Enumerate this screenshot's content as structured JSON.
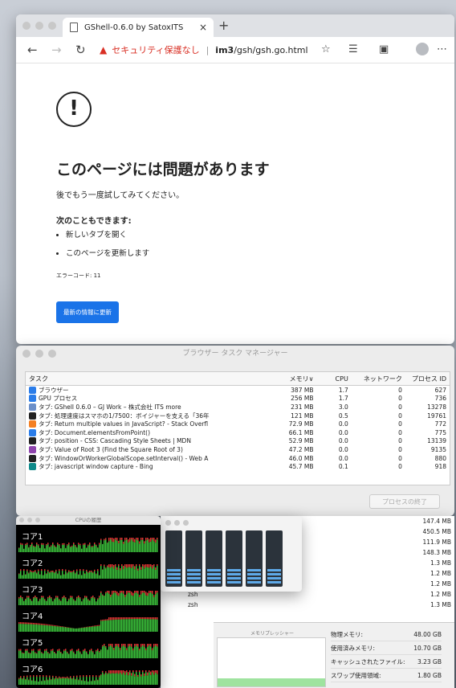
{
  "browser": {
    "tab_title": "GShell-0.6.0 by SatoxITS",
    "tab_close": "×",
    "new_tab": "+",
    "back": "←",
    "forward": "→",
    "reload": "↻",
    "insecure_label": "セキュリティ保護なし",
    "url_sep": "|",
    "url_host": "im3",
    "url_path": "/gsh/gsh.go.html",
    "error": {
      "heading": "このページには問題があります",
      "retry_text": "後でもう一度試してみてください。",
      "also_heading": "次のこともできます:",
      "suggestions": [
        "新しいタブを開く",
        "このページを更新します"
      ],
      "error_code": "エラーコード: 11",
      "reload_button": "最新の情報に更新"
    }
  },
  "task_manager": {
    "title": "ブラウザー タスク マネージャー",
    "columns": {
      "task": "タスク",
      "memory": "メモリ∨",
      "cpu": "CPU",
      "network": "ネットワーク",
      "pid": "プロセス ID"
    },
    "rows": [
      {
        "task": "ブラウザー",
        "memory": "387 MB",
        "cpu": "1.7",
        "network": "0",
        "pid": "627",
        "icon_color": "#2b7de9"
      },
      {
        "task": "GPU プロセス",
        "memory": "256 MB",
        "cpu": "1.7",
        "network": "0",
        "pid": "736",
        "icon_color": "#2b7de9"
      },
      {
        "task": "タブ: GShell 0.6.0 – GJ Work – 株式会社 ITS more",
        "memory": "231 MB",
        "cpu": "3.0",
        "network": "0",
        "pid": "13278",
        "icon_color": "#6b8fc9"
      },
      {
        "task": "タブ: 処理速度はスマホの1/7500：ボイジャーを支える「36年",
        "memory": "121 MB",
        "cpu": "0.5",
        "network": "0",
        "pid": "19761",
        "icon_color": "#222222"
      },
      {
        "task": "タブ: Return multiple values in JavaScript? - Stack Overfl",
        "memory": "72.9 MB",
        "cpu": "0.0",
        "network": "0",
        "pid": "772",
        "icon_color": "#f48024"
      },
      {
        "task": "タブ: Document.elementsFromPoint()",
        "memory": "66.1 MB",
        "cpu": "0.0",
        "network": "0",
        "pid": "775",
        "icon_color": "#2b7de9"
      },
      {
        "task": "タブ: position - CSS: Cascading Style Sheets | MDN",
        "memory": "52.9 MB",
        "cpu": "0.0",
        "network": "0",
        "pid": "13139",
        "icon_color": "#222222"
      },
      {
        "task": "タブ: Value of Root 3 (Find the Square Root of 3)",
        "memory": "47.2 MB",
        "cpu": "0.0",
        "network": "0",
        "pid": "9135",
        "icon_color": "#8e44ad"
      },
      {
        "task": "タブ: WindowOrWorkerGlobalScope.setInterval() - Web A",
        "memory": "46.0 MB",
        "cpu": "0.0",
        "network": "0",
        "pid": "880",
        "icon_color": "#222222"
      },
      {
        "task": "タブ: javascript window capture - Bing",
        "memory": "45.7 MB",
        "cpu": "0.1",
        "network": "0",
        "pid": "918",
        "icon_color": "#0f8a8a"
      }
    ],
    "end_process_button": "プロセスの終了"
  },
  "activity_monitor": {
    "rows": [
      {
        "name": "",
        "value": "147.4 MB"
      },
      {
        "name": "",
        "value": "450.5 MB"
      },
      {
        "name": "",
        "value": "111.9 MB"
      },
      {
        "name": "",
        "value": "148.3 MB"
      },
      {
        "name": "",
        "value": "1.3 MB"
      },
      {
        "name": "",
        "value": "1.2 MB"
      },
      {
        "name": "",
        "value": "1.2 MB"
      },
      {
        "name": "zsh",
        "value": "1.2 MB"
      },
      {
        "name": "zsh",
        "value": "1.3 MB"
      }
    ],
    "memory_pressure_label": "メモリプレッシャー",
    "stats": [
      {
        "label": "物理メモリ:",
        "value": "48.00 GB"
      },
      {
        "label": "使用済みメモリ:",
        "value": "10.70 GB"
      },
      {
        "label": "キャッシュされたファイル:",
        "value": "3.23 GB"
      },
      {
        "label": "スワップ使用領域:",
        "value": "1.80 GB"
      }
    ]
  },
  "cpu_history": {
    "title": "CPUの履歴",
    "cores": [
      "コア1",
      "コア2",
      "コア3",
      "コア4",
      "コア5",
      "コア6"
    ]
  }
}
